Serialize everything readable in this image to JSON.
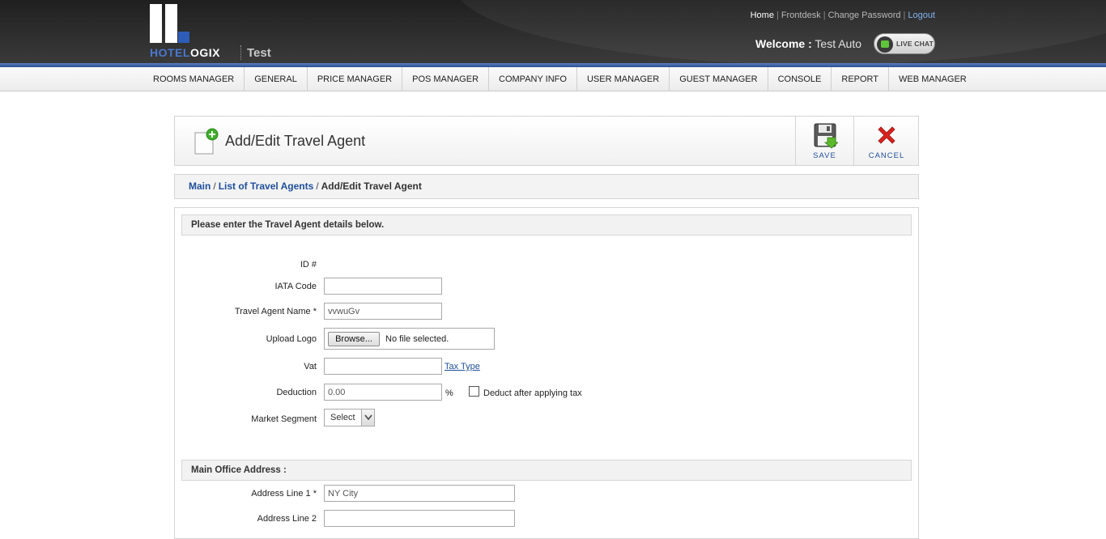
{
  "header": {
    "logo_text_blue": "HOTEL",
    "logo_text_white": "OGIX",
    "property_name": "Test",
    "toplinks": {
      "home": "Home",
      "frontdesk": "Frontdesk",
      "change_password": "Change Password",
      "logout": "Logout",
      "separator": "|"
    },
    "welcome_label": "Welcome :",
    "user_name": "Test Auto",
    "live_chat": "LIVE CHAT"
  },
  "nav": {
    "items": [
      "ROOMS MANAGER",
      "GENERAL",
      "PRICE MANAGER",
      "POS MANAGER",
      "COMPANY INFO",
      "USER MANAGER",
      "GUEST MANAGER",
      "CONSOLE",
      "REPORT",
      "WEB MANAGER"
    ]
  },
  "title_panel": {
    "title": "Add/Edit Travel Agent",
    "save_label": "SAVE",
    "cancel_label": "CANCEL"
  },
  "breadcrumb": {
    "main": "Main",
    "list": "List of Travel Agents",
    "current": "Add/Edit Travel Agent",
    "separator": "/"
  },
  "form": {
    "details_heading": "Please enter the Travel Agent details below.",
    "id_label": "ID #",
    "iata_label": "IATA Code",
    "iata_value": "",
    "name_label": "Travel Agent Name *",
    "name_value": "vvwuGv",
    "logo_label": "Upload Logo",
    "browse_label": "Browse...",
    "no_file": "No file selected.",
    "vat_label": "Vat",
    "vat_value": "",
    "tax_type_link": "Tax Type",
    "deduction_label": "Deduction",
    "deduction_value": "0.00",
    "percent": "%",
    "deduct_after_tax_label": "Deduct after applying tax",
    "deduct_after_tax_checked": false,
    "market_segment_label": "Market Segment",
    "market_segment_value": "Select",
    "address_heading": "Main Office Address :",
    "address1_label": "Address Line 1 *",
    "address1_value": "NY City",
    "address2_label": "Address Line 2",
    "address2_value": ""
  },
  "colors": {
    "link_blue": "#1f4f9e",
    "header_dark": "#2d2d2d",
    "accent_strip": "#2a4d8f",
    "logout_link": "#7fb2f0"
  }
}
